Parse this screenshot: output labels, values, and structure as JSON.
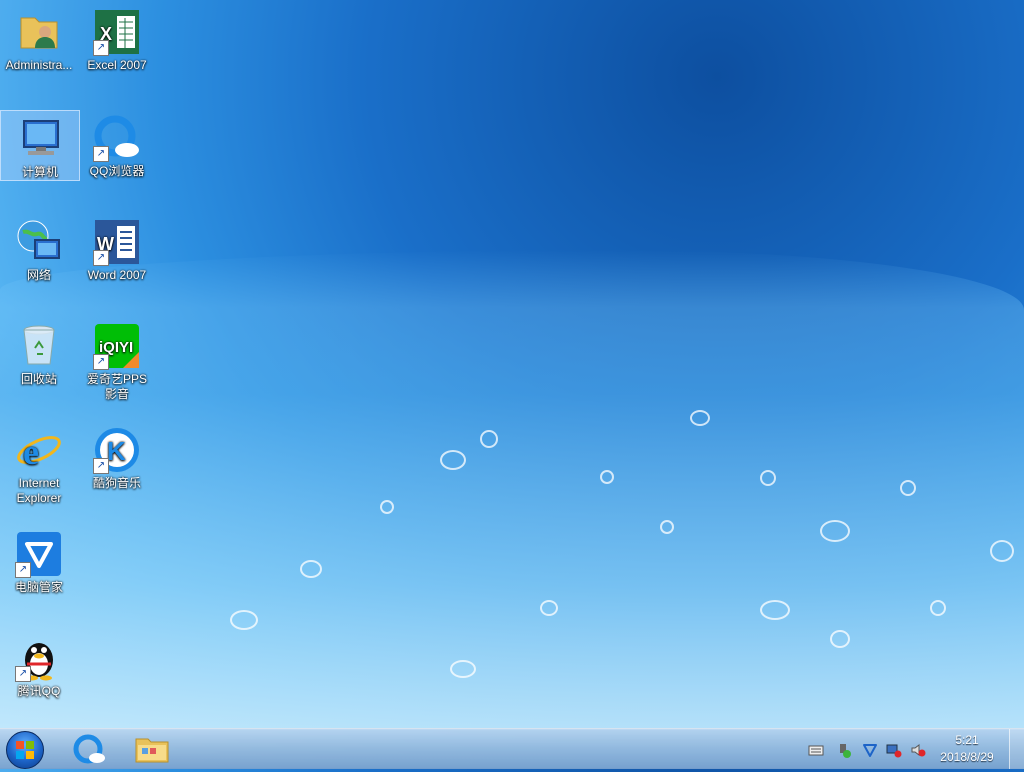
{
  "desktop": {
    "icons": [
      {
        "id": "administrator",
        "label": "Administra...",
        "icon": "user-folder-icon",
        "shortcut": false
      },
      {
        "id": "excel",
        "label": "Excel 2007",
        "icon": "excel-icon",
        "shortcut": true
      },
      {
        "id": "computer",
        "label": "计算机",
        "icon": "computer-icon",
        "shortcut": false
      },
      {
        "id": "qqbrowser",
        "label": "QQ浏览器",
        "icon": "qq-browser-icon",
        "shortcut": true
      },
      {
        "id": "network",
        "label": "网络",
        "icon": "network-globe-icon",
        "shortcut": false
      },
      {
        "id": "word",
        "label": "Word 2007",
        "icon": "word-icon",
        "shortcut": true
      },
      {
        "id": "recycle",
        "label": "回收站",
        "icon": "recycle-bin-icon",
        "shortcut": false
      },
      {
        "id": "iqiyi",
        "label": "爱奇艺PPS 影音",
        "icon": "iqiyi-icon",
        "shortcut": true
      },
      {
        "id": "ie",
        "label": "Internet Explorer",
        "icon": "internet-explorer-icon",
        "shortcut": false
      },
      {
        "id": "kugou",
        "label": "酷狗音乐",
        "icon": "kugou-music-icon",
        "shortcut": true
      },
      {
        "id": "pcmanager",
        "label": "电脑管家",
        "icon": "pc-manager-icon",
        "shortcut": true
      },
      {
        "id": "qq",
        "label": "腾讯QQ",
        "icon": "qq-penguin-icon",
        "shortcut": true
      }
    ]
  },
  "taskbar": {
    "start_icon": "windows-start-icon",
    "pinned": [
      {
        "name": "qq-browser-taskbar",
        "icon": "qq-browser-icon"
      },
      {
        "name": "file-explorer-taskbar",
        "icon": "folder-icon"
      }
    ],
    "tray": [
      {
        "name": "keyboard-icon"
      },
      {
        "name": "usb-device-icon"
      },
      {
        "name": "shield-tray-icon"
      },
      {
        "name": "network-status-icon"
      },
      {
        "name": "volume-muted-icon"
      }
    ],
    "clock": {
      "time": "5:21",
      "date": "2018/8/29"
    }
  },
  "colors": {
    "accent": "#1d64c8",
    "excel": "#1e7145",
    "word": "#2b579a",
    "iqiyi": "#00be06",
    "kugou": "#1d8ae6"
  }
}
